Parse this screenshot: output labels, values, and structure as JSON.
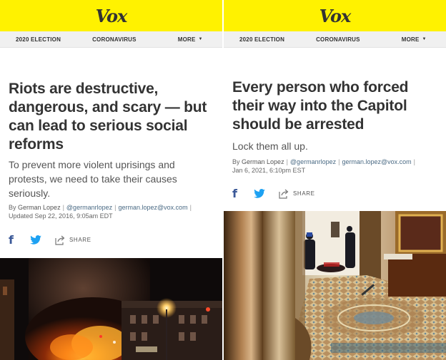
{
  "left": {
    "brand": "Vox",
    "nav": {
      "item1": "2020 ELECTION",
      "item2": "CORONAVIRUS",
      "more": "MORE"
    },
    "headline": "Riots are destructive, dangerous, and scary — but can lead to serious social reforms",
    "dek": "To prevent more violent uprisings and protests, we need to take their causes seriously.",
    "byline": {
      "prefix": "By",
      "author": "German Lopez",
      "handle": "@germanrlopez",
      "email": "german.lopez@vox.com",
      "updated": "Updated Sep 22, 2016, 9:05am EDT"
    },
    "share": {
      "label": "SHARE"
    }
  },
  "right": {
    "brand": "Vox",
    "nav": {
      "item1": "2020 ELECTION",
      "item2": "CORONAVIRUS",
      "more": "MORE"
    },
    "headline": "Every person who forced their way into the Capitol should be arrested",
    "dek": "Lock them all up.",
    "byline": {
      "prefix": "By",
      "author": "German Lopez",
      "handle": "@germanrlopez",
      "email": "german.lopez@vox.com",
      "date": "Jan 6, 2021, 6:10pm EST"
    },
    "share": {
      "label": "SHARE"
    }
  },
  "colors": {
    "brand_yellow": "#fff200",
    "nav_bg": "#f0f0f0",
    "facebook": "#3b5998",
    "twitter": "#1da1f2",
    "link": "#4a6a84"
  },
  "icons": {
    "share": "share-arrow-icon",
    "facebook": "facebook-icon",
    "twitter": "twitter-icon",
    "caret": "caret-down-icon"
  }
}
